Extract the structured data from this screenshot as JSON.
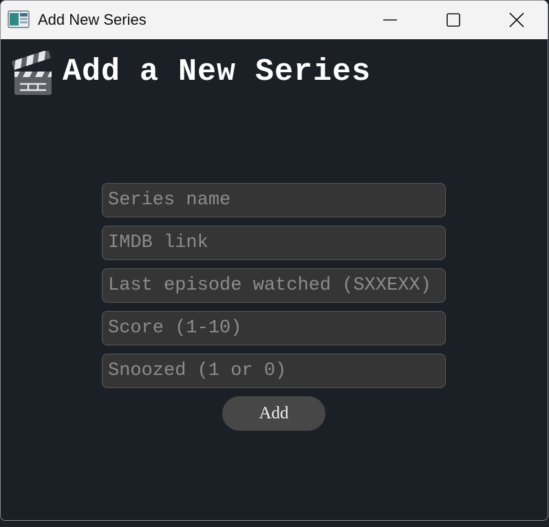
{
  "window": {
    "title": "Add New Series",
    "app_icon": "app-window-icon",
    "controls": [
      "minimize-icon",
      "maximize-icon",
      "close-icon"
    ]
  },
  "header": {
    "icon": "clapperboard-icon",
    "title": "Add a New Series"
  },
  "form": {
    "series_name": {
      "placeholder": "Series name",
      "value": ""
    },
    "imdb_link": {
      "placeholder": "IMDB link",
      "value": ""
    },
    "last_episode": {
      "placeholder": "Last episode watched (SXXEXX)",
      "value": ""
    },
    "score": {
      "placeholder": "Score (1-10)",
      "value": ""
    },
    "snoozed": {
      "placeholder": "Snoozed (1 or 0)",
      "value": ""
    },
    "submit_label": "Add"
  },
  "colors": {
    "background": "#1b1f26",
    "field_background": "#353535",
    "button_background": "#474747",
    "titlebar": "#f3f3f3"
  }
}
